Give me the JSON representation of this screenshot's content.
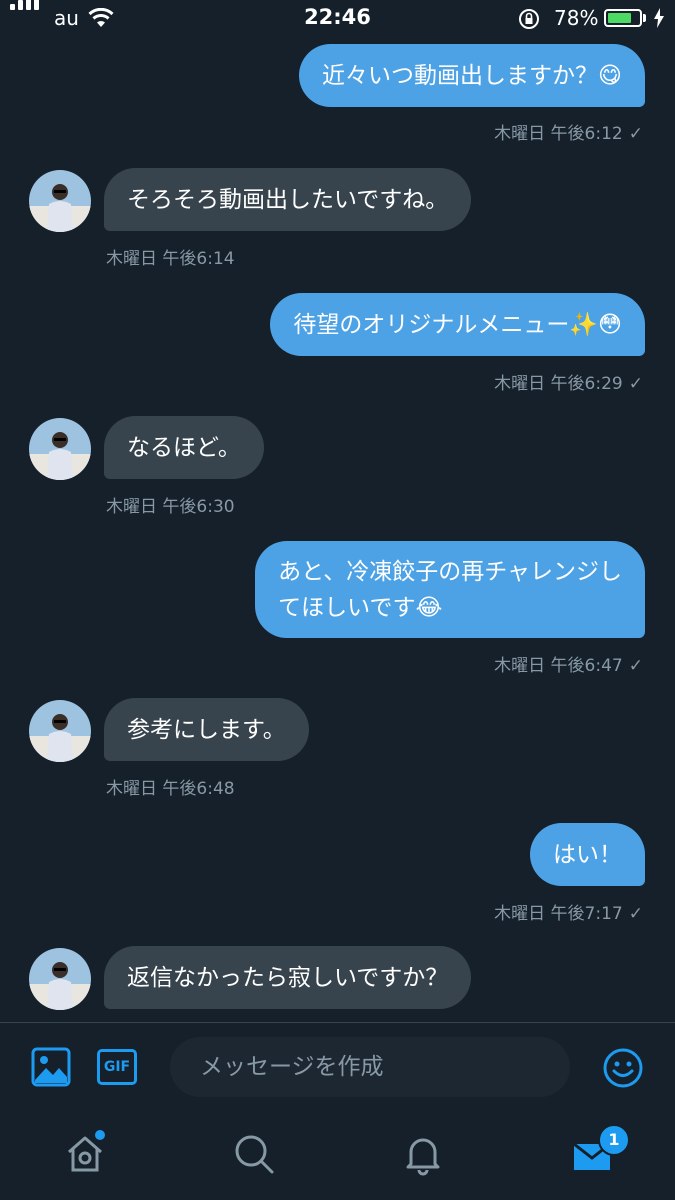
{
  "status_bar": {
    "carrier": "au",
    "time": "22:46",
    "battery_percent": "78%",
    "battery_level": 0.78
  },
  "messages": [
    {
      "dir": "out",
      "text": "近々いつ動画出しますか？😋",
      "time": "木曜日 午後6:12",
      "check": "✓"
    },
    {
      "dir": "in",
      "text": "そろそろ動画出したいですね。",
      "time": "木曜日 午後6:14"
    },
    {
      "dir": "out",
      "text": "待望のオリジナルメニュー✨😳",
      "time": "木曜日 午後6:29",
      "check": "✓"
    },
    {
      "dir": "in",
      "text": "なるほど。",
      "time": "木曜日 午後6:30"
    },
    {
      "dir": "out",
      "text_line1": "あと、冷凍餃子の再チャレンジし",
      "text_line2": "てほしいです😂",
      "time": "木曜日 午後6:47",
      "check": "✓"
    },
    {
      "dir": "in",
      "text": "参考にします。",
      "time": "木曜日 午後6:48"
    },
    {
      "dir": "out",
      "text": "はい！",
      "time": "木曜日 午後7:17",
      "check": "✓"
    },
    {
      "dir": "in",
      "text": "返信なかったら寂しいですか？"
    }
  ],
  "composer": {
    "placeholder": "メッセージを作成",
    "gif_label": "GIF"
  },
  "tabbar": {
    "messages_badge": "1"
  },
  "colors": {
    "background": "#15202b",
    "outgoing_bubble": "#4da2e6",
    "incoming_bubble": "#38444d",
    "accent": "#1d9bf0",
    "meta_text": "#8899a6"
  },
  "icons": [
    "signal-icon",
    "wifi-icon",
    "orientation-lock-icon",
    "battery-icon",
    "charging-bolt-icon",
    "image-icon",
    "gif-icon",
    "emoji-icon",
    "home-icon",
    "search-icon",
    "bell-icon",
    "mail-icon"
  ]
}
